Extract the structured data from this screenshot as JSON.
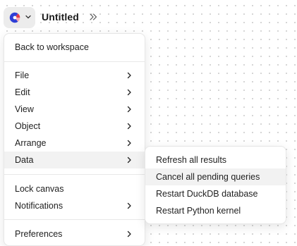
{
  "header": {
    "title": "Untitled",
    "logo_icon": "app-logo",
    "menu_toggle_icon": "chevron-down-icon",
    "expand_icon": "double-chevron-right-icon"
  },
  "main_menu": {
    "items": [
      {
        "label": "Back to workspace"
      },
      {
        "label": "File",
        "submenu": true
      },
      {
        "label": "Edit",
        "submenu": true
      },
      {
        "label": "View",
        "submenu": true
      },
      {
        "label": "Object",
        "submenu": true
      },
      {
        "label": "Arrange",
        "submenu": true
      },
      {
        "label": "Data",
        "submenu": true,
        "active": true
      },
      {
        "label": "Lock canvas"
      },
      {
        "label": "Notifications",
        "submenu": true
      },
      {
        "label": "Preferences",
        "submenu": true
      }
    ]
  },
  "data_submenu": {
    "items": [
      {
        "label": "Refresh all results"
      },
      {
        "label": "Cancel all pending queries",
        "hovered": true
      },
      {
        "label": "Restart DuckDB database"
      },
      {
        "label": "Restart Python kernel"
      }
    ]
  },
  "colors": {
    "logo_blue": "#2f3fd6",
    "logo_red": "#e23b4c",
    "hover_background": "#f2f2f2"
  }
}
